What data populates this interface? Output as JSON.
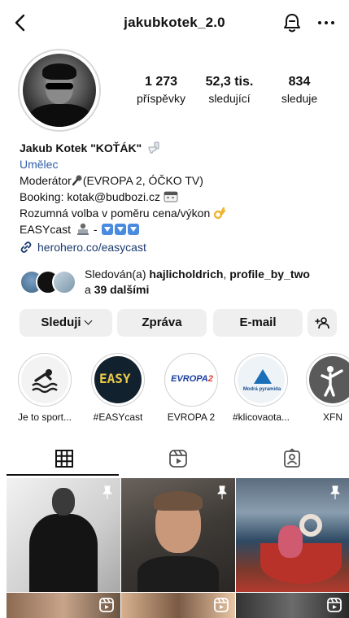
{
  "header": {
    "username": "jakubkotek_2.0",
    "icons": [
      "back-arrow-icon",
      "notification-bell-icon",
      "more-icon"
    ]
  },
  "stats": [
    {
      "value": "1 273",
      "label": "příspěvky"
    },
    {
      "value": "52,3 tis.",
      "label": "sledující"
    },
    {
      "value": "834",
      "label": "sleduje"
    }
  ],
  "bio": {
    "name": "Jakub Kotek \"KOŤÁK\"",
    "category": "Umělec",
    "lines": [
      "Moderátor",
      "(EVROPA 2, ÓČKO TV)",
      "Booking: kotak@budbozi.cz",
      "Rozumná volba v poměru cena/výkon",
      "EASYcast",
      "-"
    ],
    "link": "herohero.co/easycast"
  },
  "followed_by": {
    "prefix": "Sledován(a) ",
    "user1": "hajlicholdrich",
    "sep": ", ",
    "user2": "profile_by_two",
    "mid": "a ",
    "more": "39 dalšími"
  },
  "buttons": {
    "follow": "Sleduji",
    "message": "Zpráva",
    "email": "E-mail"
  },
  "highlights": [
    {
      "label": "Je to sport..."
    },
    {
      "label": "#EASYcast",
      "art_text": "EASY"
    },
    {
      "label": "EVROPA 2",
      "art_text_a": "EVROPA",
      "art_text_b": "2"
    },
    {
      "label": "#klicovaota...",
      "art_text": "Modrá pyramida"
    },
    {
      "label": "XFN"
    }
  ],
  "tabs": [
    "grid-icon",
    "reels-icon",
    "tagged-icon"
  ],
  "colors": {
    "category": "#2f5ea8",
    "link": "#1a3a6e",
    "button_bg": "#efefef"
  }
}
